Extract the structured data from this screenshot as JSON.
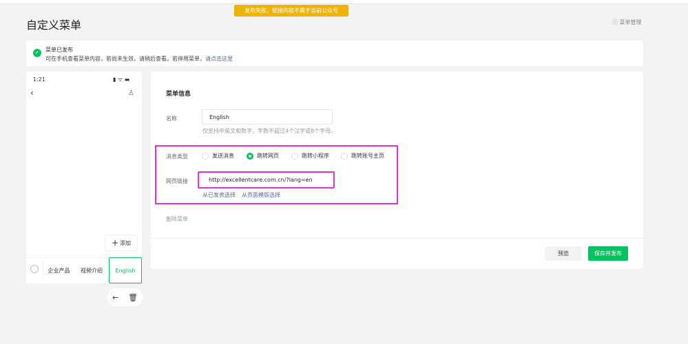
{
  "toast": "发布失败，链接内容不属于当前公众号",
  "page_title": "自定义菜单",
  "menu_manage": "菜单管理",
  "notice": {
    "title": "菜单已发布",
    "text": "可在手机查看菜单内容，若尚未生效，请稍后查看。若停用菜单，",
    "link": "请点击这里"
  },
  "phone": {
    "time": "1:21",
    "add_label": "添加",
    "menus": [
      "企业产品",
      "视频介绍",
      "English"
    ]
  },
  "form": {
    "section_title": "菜单信息",
    "name_label": "名称",
    "name_value": "English",
    "name_hint": "仅支持中英文和数字，字数不超过4个汉字或8个字母。",
    "type_label": "消息类型",
    "types": [
      "发送消息",
      "跳转网页",
      "跳转小程序",
      "跳转账号主页"
    ],
    "selected_type": "跳转网页",
    "url_label": "网页链接",
    "url_value": "http://excellentcare.com.cn/?lang=en",
    "pick_published": "从已发表选择",
    "pick_template": "从页面模版选择",
    "delete": "删除菜单"
  },
  "actions": {
    "preview": "预览",
    "save": "保存并发布"
  },
  "colors": {
    "accent": "#07c160",
    "toast": "#f0b400",
    "highlight": "#e030d8",
    "link": "#576b95"
  }
}
